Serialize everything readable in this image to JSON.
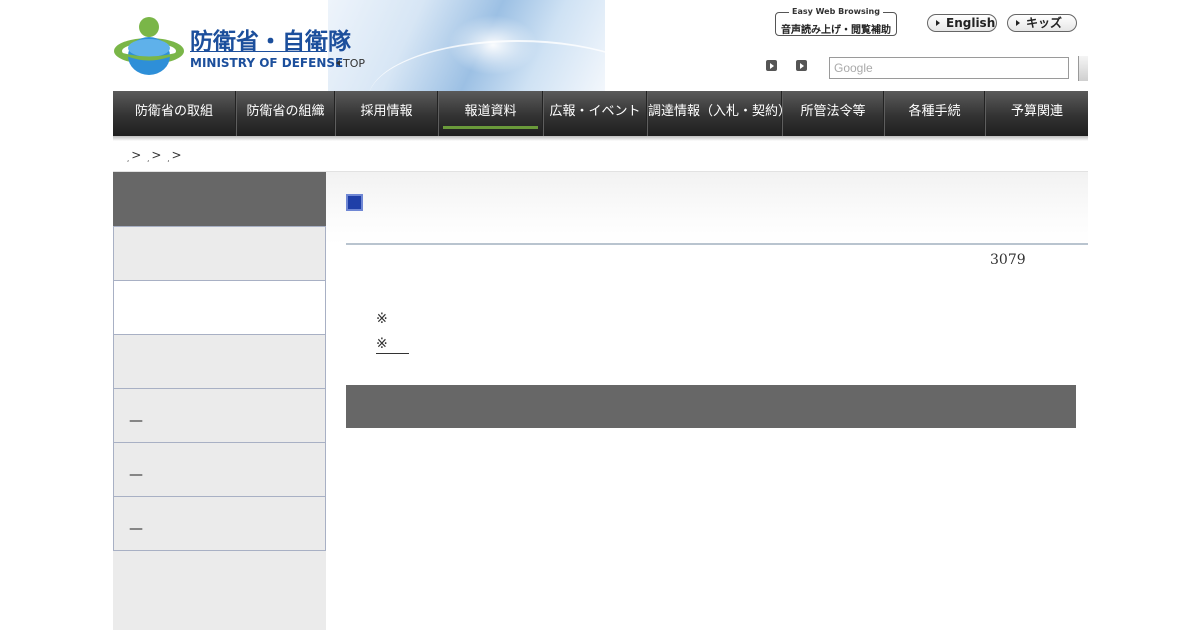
{
  "header": {
    "logo_title": "防衛省・自衛隊",
    "logo_subtitle": "MINISTRY OF DEFENSE",
    "top_link": "TOP",
    "easy_web_en": "Easy Web Browsing",
    "easy_web_ja": "音声読み上げ・閲覧補助",
    "english_link": "English",
    "kids_link": "キッズ",
    "search_placeholder": "Google"
  },
  "nav": {
    "items": [
      {
        "label": "防衛省の取組",
        "active": false
      },
      {
        "label": "防衛省の組織",
        "active": false
      },
      {
        "label": "採用情報",
        "active": false
      },
      {
        "label": "報道資料",
        "active": true
      },
      {
        "label": "広報・イベント",
        "active": false
      },
      {
        "label": "調達情報（入札・契約）",
        "active": false
      },
      {
        "label": "所管法令等",
        "active": false
      },
      {
        "label": "各種手続",
        "active": false
      },
      {
        "label": "予算関連",
        "active": false
      }
    ]
  },
  "breadcrumb": {
    "separator": ">",
    "dot": ","
  },
  "sidebar": {
    "items": [
      {
        "label": ""
      },
      {
        "label": ""
      },
      {
        "label": ""
      },
      {
        "label": "—"
      },
      {
        "label": "—"
      },
      {
        "label": "—"
      }
    ]
  },
  "main": {
    "number": "3079",
    "note1": "※",
    "note2": "※"
  },
  "colors": {
    "nav_active_underline": "#6a9a3a",
    "title_square": "#1f3fa8",
    "sidebar_header": "#676767",
    "logo_blue": "#1c4f9c"
  }
}
